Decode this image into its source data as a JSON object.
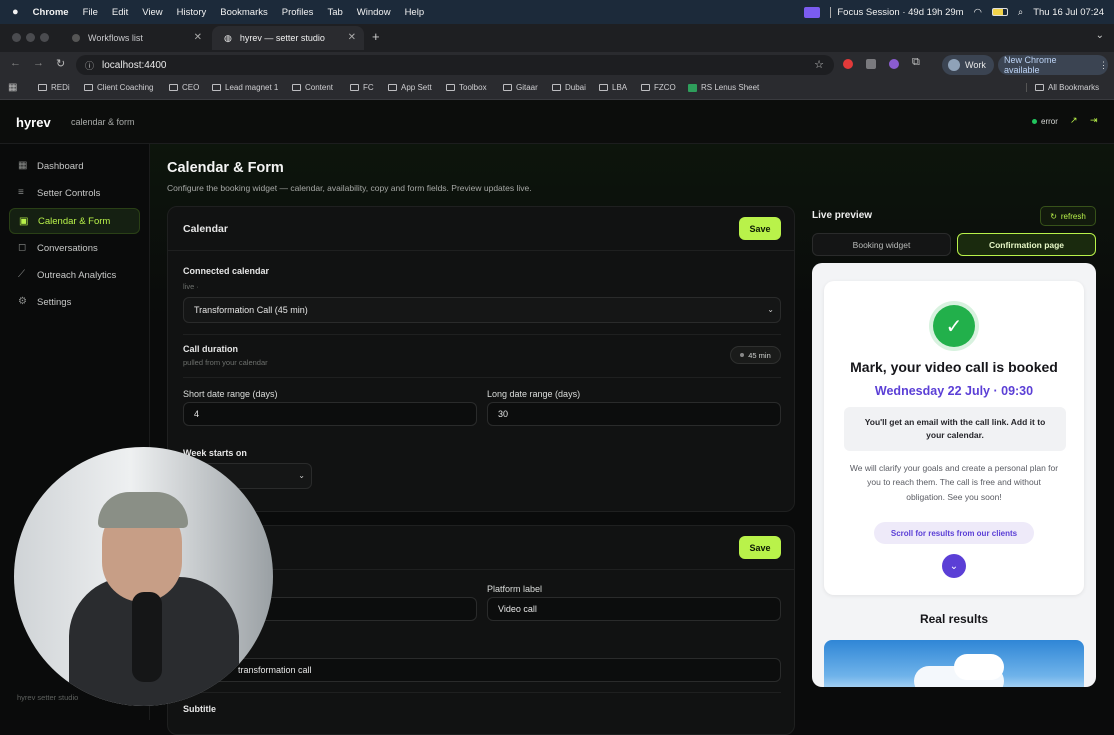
{
  "menubar": {
    "app": "Chrome",
    "items": [
      "File",
      "Edit",
      "View",
      "History",
      "Bookmarks",
      "Profiles",
      "Tab",
      "Window",
      "Help"
    ],
    "focus": "Focus Session · 49d 19h 29m",
    "datetime": "Thu 16 Jul  07:24"
  },
  "tabs": [
    {
      "label": "Workflows list"
    },
    {
      "label": "hyrev — setter studio"
    }
  ],
  "toolbar": {
    "url": "localhost:4400",
    "profile": "Work",
    "update": "New Chrome available"
  },
  "bookmarks": [
    "REDi",
    "Client Coaching",
    "CEO",
    "Lead magnet 1",
    "Content",
    "FC",
    "App Sett",
    "Toolbox",
    "Gitaar",
    "Dubai",
    "LBA",
    "FZCO",
    "RS Lenus Sheet"
  ],
  "all_bookmarks": "All Bookmarks",
  "app": {
    "logo": "hyrev",
    "section": "calendar & form",
    "status": "error",
    "footer": "hyrev setter studio"
  },
  "nav": [
    {
      "label": "Dashboard",
      "icon": "grid-icon"
    },
    {
      "label": "Setter Controls",
      "icon": "sliders-icon"
    },
    {
      "label": "Calendar & Form",
      "icon": "calendar-icon"
    },
    {
      "label": "Conversations",
      "icon": "chat-icon"
    },
    {
      "label": "Outreach Analytics",
      "icon": "chart-icon"
    },
    {
      "label": "Settings",
      "icon": "gear-icon"
    }
  ],
  "page": {
    "title": "Calendar & Form",
    "subtitle": "Configure the booking widget — calendar, availability, copy and form fields. Preview updates live."
  },
  "calendar_card": {
    "title": "Calendar",
    "save": "Save",
    "connected_label": "Connected calendar",
    "connected_sub": "live ·",
    "connected_value": "Transformation Call (45 min)",
    "duration_label": "Call duration",
    "duration_sub": "pulled from your calendar",
    "duration_badge": "45 min",
    "short_label": "Short date range (days)",
    "short_value": "4",
    "long_label": "Long date range (days)",
    "long_value": "30",
    "week_label": "Week starts on"
  },
  "form_card": {
    "save": "Save",
    "platform_label": "Platform label",
    "platform_value": "Video call",
    "title_value": "transformation call",
    "subtitle_label": "Subtitle"
  },
  "preview": {
    "title": "Live preview",
    "refresh": "refresh",
    "tab_booking": "Booking widget",
    "tab_confirm": "Confirmation page",
    "headline": "Mark, your video call is booked",
    "date": "Wednesday 22 July · 09:30",
    "email_note": "You'll get an email with the call link. Add it to your calendar.",
    "body": "We will clarify your goals and create a personal plan for you to reach them. The call is free and without obligation. See you soon!",
    "scroll": "Scroll for results from our clients",
    "results": "Real results"
  },
  "colors": {
    "accent": "#b9f24a",
    "brand_purple": "#5b3fd6",
    "success": "#22b04b",
    "error": "#22c55e"
  }
}
